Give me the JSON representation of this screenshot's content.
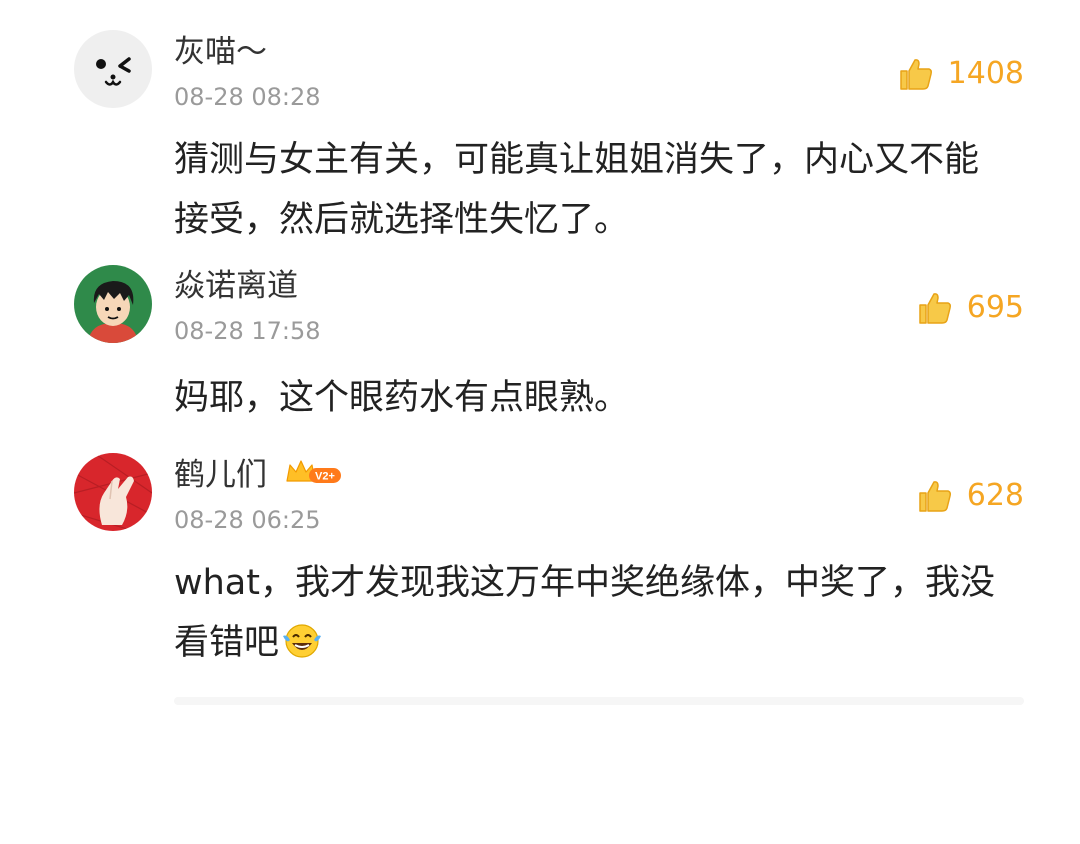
{
  "comments": [
    {
      "username": "灰喵～",
      "time": "08-28 08:28",
      "likes": "1408",
      "body": "猜测与女主有关，可能真让姐姐消失了，内心又不能接受，然后就选择性失忆了。",
      "avatar_icon": "white-cat-face-avatar"
    },
    {
      "username": "焱诺离道",
      "time": "08-28 17:58",
      "likes": "695",
      "body": "妈耶，这个眼药水有点眼熟。",
      "avatar_icon": "cartoon-boy-avatar"
    },
    {
      "username": "鹤儿们",
      "vip_badge": "V2+",
      "time": "08-28 06:25",
      "likes": "628",
      "body": "what，我才发现我这万年中奖绝缘体，中奖了，我没看错吧",
      "body_emoji": "laugh-cry-emoji",
      "avatar_icon": "finger-heart-avatar"
    }
  ],
  "colors": {
    "like_accent": "#f5a623",
    "username": "#333333",
    "time": "#9a9a9a",
    "body": "#222222"
  }
}
